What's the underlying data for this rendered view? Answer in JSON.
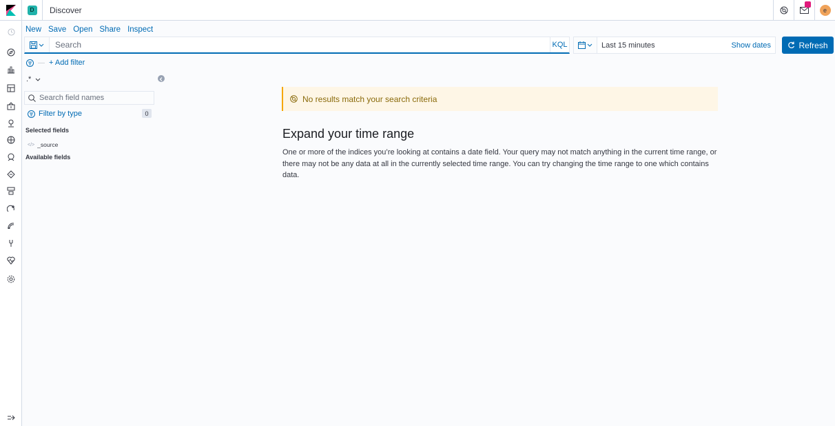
{
  "header": {
    "space_initial": "D",
    "title": "Discover",
    "user_initial": "e"
  },
  "menu": {
    "new": "New",
    "save": "Save",
    "open": "Open",
    "share": "Share",
    "inspect": "Inspect"
  },
  "query": {
    "placeholder": "Search",
    "language": "KQL"
  },
  "datepicker": {
    "range": "Last 15 minutes",
    "show_dates": "Show dates"
  },
  "refresh_label": "Refresh",
  "filter": {
    "add_label": "+ Add filter"
  },
  "sidebar": {
    "index_pattern": ".*",
    "search_placeholder": "Search field names",
    "filter_by_type": "Filter by type",
    "filter_count": "0",
    "selected_title": "Selected fields",
    "selected_fields": [
      "_source"
    ],
    "available_title": "Available fields"
  },
  "main": {
    "callout": "No results match your search criteria",
    "title": "Expand your time range",
    "description": "One or more of the indices you’re looking at contains a date field. Your query may not match anything in the current time range, or there may not be any data at all in the currently selected time range. You can try changing the time range to one which contains data."
  },
  "colors": {
    "accent": "#006bb4",
    "warning": "#f5a700"
  }
}
